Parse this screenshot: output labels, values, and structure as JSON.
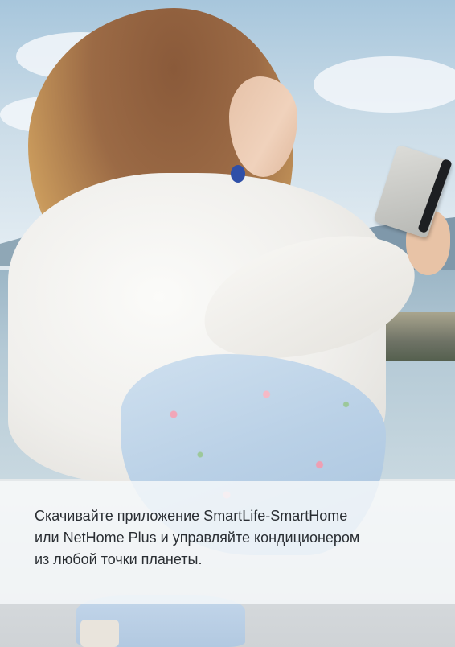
{
  "caption": {
    "line1": "Скачивайте приложение SmartLife-SmartHome",
    "line2": "или NetHome Plus и управляйте кондиционером",
    "line3": "из любой точки планеты."
  },
  "colors": {
    "caption_text": "#2a2e33",
    "caption_band": "#f7f9fa",
    "phone_strap": "#1d1f22",
    "earring": "#2f4fa8"
  }
}
